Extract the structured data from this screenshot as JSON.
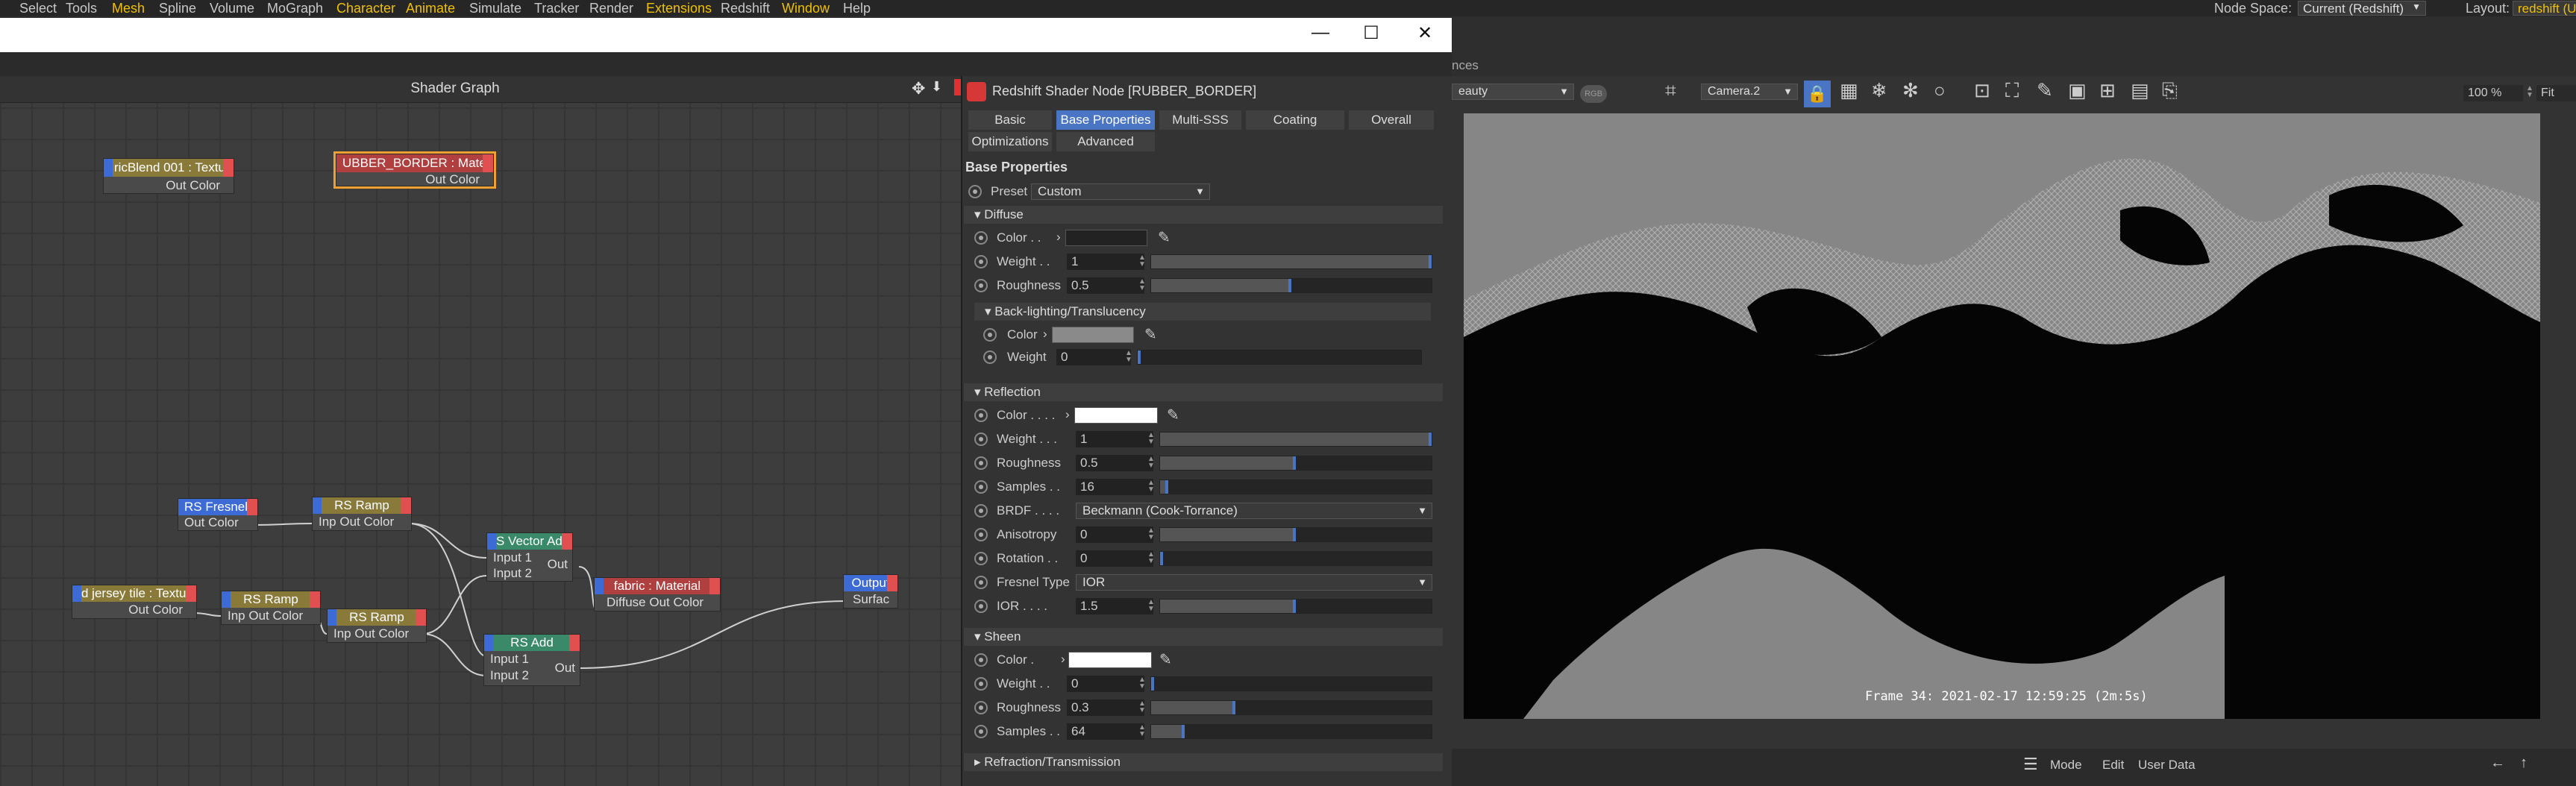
{
  "menubar": {
    "items": [
      {
        "label": "Select",
        "accent": false
      },
      {
        "label": "Tools",
        "accent": false
      },
      {
        "label": "Mesh",
        "accent": true
      },
      {
        "label": "Spline",
        "accent": false
      },
      {
        "label": "Volume",
        "accent": false
      },
      {
        "label": "MoGraph",
        "accent": false
      },
      {
        "label": "Character",
        "accent": true
      },
      {
        "label": "Animate",
        "accent": true
      },
      {
        "label": "Simulate",
        "accent": false
      },
      {
        "label": "Tracker",
        "accent": false
      },
      {
        "label": "Render",
        "accent": false
      },
      {
        "label": "Extensions",
        "accent": true
      },
      {
        "label": "Redshift",
        "accent": false
      },
      {
        "label": "Window",
        "accent": true
      },
      {
        "label": "Help",
        "accent": false
      }
    ],
    "node_space_label": "Node Space:",
    "node_space_value": "Current (Redshift)",
    "layout_label": "Layout:",
    "layout_value": "redshift (U"
  },
  "window_controls": {
    "minimize": "—",
    "maximize": "☐",
    "close": "✕"
  },
  "shader_graph": {
    "title": "Shader Graph",
    "nodes": {
      "fabric_blend": {
        "title": "ricBlend 001 : Textu",
        "out": "Out Color"
      },
      "rubber_border": {
        "title": "UBBER_BORDER : Materi",
        "out": "Out Color"
      },
      "fresnel": {
        "title": "RS Fresnel",
        "out": "Out Color"
      },
      "ramp1": {
        "title": "RS Ramp",
        "in": "Inp",
        "out": "Out Color"
      },
      "vector_add": {
        "title": "S Vector Ad",
        "in1": "Input 1",
        "in2": "Input 2",
        "out": "Out"
      },
      "jersey": {
        "title": "d jersey tile : Textu",
        "out": "Out Color"
      },
      "ramp2": {
        "title": "RS Ramp",
        "in": "Inp",
        "out": "Out Color"
      },
      "ramp3": {
        "title": "RS Ramp",
        "in": "Inp",
        "out": "Out Color"
      },
      "fabric_mat": {
        "title": "fabric : Material",
        "in": "Diffuse",
        "out": "Out Color"
      },
      "output": {
        "title": "Output",
        "in": "Surfac"
      },
      "rs_add": {
        "title": "RS Add",
        "in1": "Input 1",
        "in2": "Input 2",
        "out": "Out"
      }
    }
  },
  "attributes": {
    "title": "Redshift Shader Node [RUBBER_BORDER]",
    "tabs": [
      "Basic",
      "Base Properties",
      "Multi-SSS",
      "Coating",
      "Overall",
      "Optimizations",
      "Advanced"
    ],
    "active_tab": "Base Properties",
    "heading": "Base Properties",
    "preset": {
      "label": "Preset",
      "value": "Custom"
    },
    "diffuse": {
      "title": "Diffuse",
      "color_label": "Color . .",
      "weight_label": "Weight . .",
      "weight": "1",
      "weight_frac": 1.0,
      "rough_label": "Roughness",
      "rough": "0.5",
      "rough_frac": 0.5
    },
    "backlight": {
      "title": "Back-lighting/Translucency",
      "color_label": "Color",
      "weight_label": "Weight",
      "weight": "0",
      "weight_frac": 0.0
    },
    "reflection": {
      "title": "Reflection",
      "color_label": "Color . . . .",
      "weight_label": "Weight . . .",
      "weight": "1",
      "weight_frac": 1.0,
      "rough_label": "Roughness",
      "rough": "0.5",
      "rough_frac": 0.5,
      "samples_label": "Samples . .",
      "samples": "16",
      "samples_frac": 0.03,
      "brdf_label": "BRDF . . . .",
      "brdf": "Beckmann (Cook-Torrance)",
      "aniso_label": "Anisotropy",
      "aniso": "0",
      "aniso_frac": 0.5,
      "rot_label": "Rotation . .",
      "rot": "0",
      "rot_frac": 0.0,
      "fresnel_label": "Fresnel Type",
      "fresnel": "IOR",
      "ior_label": "IOR . . . .",
      "ior": "1.5",
      "ior_frac": 0.5
    },
    "sheen": {
      "title": "Sheen",
      "color_label": "Color .",
      "weight_label": "Weight . .",
      "weight": "0",
      "weight_frac": 0.0,
      "rough_label": "Roughness",
      "rough": "0.3",
      "rough_frac": 0.3,
      "samples_label": "Samples . .",
      "samples": "64",
      "samples_frac": 0.12
    },
    "refraction": {
      "title": "Refraction/Transmission"
    }
  },
  "viewport": {
    "beauty": "eauty",
    "camera": "Camera.2",
    "zoom": "100 %",
    "fit": "Fit Win",
    "frame_label": "Frame 34: 2021-02-17 12:59:25 (2m:5s)",
    "nodes_label": "nces"
  },
  "bottom": {
    "mode": "Mode",
    "edit": "Edit",
    "user_data": "User Data"
  },
  "colors": {
    "accent": "#f0c000",
    "tab_active": "#4a74c4",
    "redshift": "#d63838"
  }
}
